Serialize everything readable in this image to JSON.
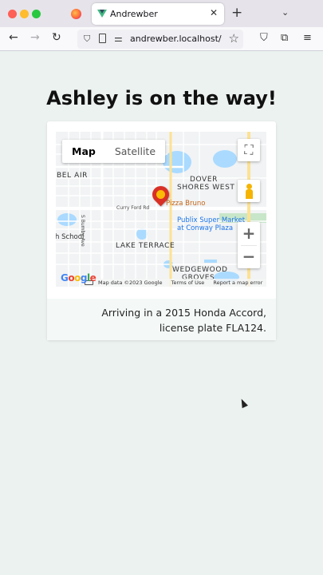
{
  "browser": {
    "active_tab_title": "Andrewber",
    "tab_close": "✕",
    "new_tab": "+",
    "tab_list": "⌄",
    "url": "andrewber.localhost/tri"
  },
  "icons": {
    "back": "←",
    "forward": "→",
    "reload": "↻",
    "shield": "⛉",
    "tune": "⚌",
    "star": "☆",
    "pocket": "⛉",
    "extensions": "⧉",
    "menu": "≡"
  },
  "page": {
    "heading": "Ashley is on the way!",
    "arrival_text": "Arriving in a 2015 Honda Accord, license plate FLA124."
  },
  "map": {
    "type_map": "Map",
    "type_satellite": "Satellite",
    "fullscreen": "⛶",
    "zoom_in": "+",
    "zoom_out": "−",
    "labels": {
      "bel_air": "BEL AIR",
      "dover_shores_1": "DOVER",
      "dover_shores_2": "SHORES WEST",
      "curry_ford": "Curry Ford Rd",
      "s_bumby": "S Bumby Ave",
      "school": "h School",
      "lake_terrace": "LAKE TERRACE",
      "wedgewood_1": "WEDGEWOOD",
      "wedgewood_2": "GROVES",
      "pizza_bruno": "Pizza Bruno",
      "publix_1": "Publix Super Market",
      "publix_2": "at Conway Plaza"
    },
    "google_logo": {
      "g1": "G",
      "o1": "o",
      "o2": "o",
      "g2": "g",
      "l": "l",
      "e": "e"
    },
    "attribution": {
      "map_data": "Map data ©2023 Google",
      "terms": "Terms of Use",
      "report": "Report a map error"
    },
    "colors": {
      "water": "#aadaff",
      "road_major": "#fde293",
      "park": "#c8e6c9",
      "pin": "#d93025"
    }
  }
}
